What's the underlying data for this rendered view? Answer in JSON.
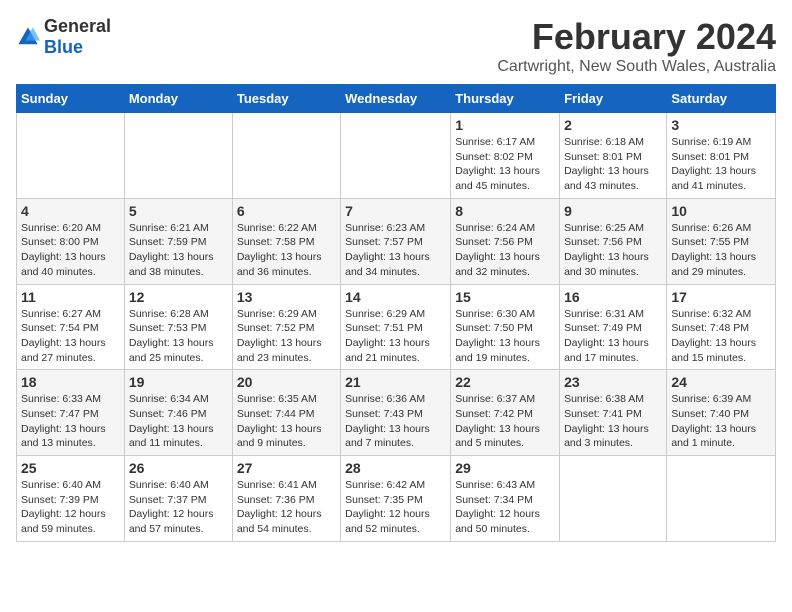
{
  "header": {
    "logo_general": "General",
    "logo_blue": "Blue",
    "main_title": "February 2024",
    "subtitle": "Cartwright, New South Wales, Australia"
  },
  "days_of_week": [
    "Sunday",
    "Monday",
    "Tuesday",
    "Wednesday",
    "Thursday",
    "Friday",
    "Saturday"
  ],
  "weeks": [
    [
      {
        "day": "",
        "info": ""
      },
      {
        "day": "",
        "info": ""
      },
      {
        "day": "",
        "info": ""
      },
      {
        "day": "",
        "info": ""
      },
      {
        "day": "1",
        "info": "Sunrise: 6:17 AM\nSunset: 8:02 PM\nDaylight: 13 hours\nand 45 minutes."
      },
      {
        "day": "2",
        "info": "Sunrise: 6:18 AM\nSunset: 8:01 PM\nDaylight: 13 hours\nand 43 minutes."
      },
      {
        "day": "3",
        "info": "Sunrise: 6:19 AM\nSunset: 8:01 PM\nDaylight: 13 hours\nand 41 minutes."
      }
    ],
    [
      {
        "day": "4",
        "info": "Sunrise: 6:20 AM\nSunset: 8:00 PM\nDaylight: 13 hours\nand 40 minutes."
      },
      {
        "day": "5",
        "info": "Sunrise: 6:21 AM\nSunset: 7:59 PM\nDaylight: 13 hours\nand 38 minutes."
      },
      {
        "day": "6",
        "info": "Sunrise: 6:22 AM\nSunset: 7:58 PM\nDaylight: 13 hours\nand 36 minutes."
      },
      {
        "day": "7",
        "info": "Sunrise: 6:23 AM\nSunset: 7:57 PM\nDaylight: 13 hours\nand 34 minutes."
      },
      {
        "day": "8",
        "info": "Sunrise: 6:24 AM\nSunset: 7:56 PM\nDaylight: 13 hours\nand 32 minutes."
      },
      {
        "day": "9",
        "info": "Sunrise: 6:25 AM\nSunset: 7:56 PM\nDaylight: 13 hours\nand 30 minutes."
      },
      {
        "day": "10",
        "info": "Sunrise: 6:26 AM\nSunset: 7:55 PM\nDaylight: 13 hours\nand 29 minutes."
      }
    ],
    [
      {
        "day": "11",
        "info": "Sunrise: 6:27 AM\nSunset: 7:54 PM\nDaylight: 13 hours\nand 27 minutes."
      },
      {
        "day": "12",
        "info": "Sunrise: 6:28 AM\nSunset: 7:53 PM\nDaylight: 13 hours\nand 25 minutes."
      },
      {
        "day": "13",
        "info": "Sunrise: 6:29 AM\nSunset: 7:52 PM\nDaylight: 13 hours\nand 23 minutes."
      },
      {
        "day": "14",
        "info": "Sunrise: 6:29 AM\nSunset: 7:51 PM\nDaylight: 13 hours\nand 21 minutes."
      },
      {
        "day": "15",
        "info": "Sunrise: 6:30 AM\nSunset: 7:50 PM\nDaylight: 13 hours\nand 19 minutes."
      },
      {
        "day": "16",
        "info": "Sunrise: 6:31 AM\nSunset: 7:49 PM\nDaylight: 13 hours\nand 17 minutes."
      },
      {
        "day": "17",
        "info": "Sunrise: 6:32 AM\nSunset: 7:48 PM\nDaylight: 13 hours\nand 15 minutes."
      }
    ],
    [
      {
        "day": "18",
        "info": "Sunrise: 6:33 AM\nSunset: 7:47 PM\nDaylight: 13 hours\nand 13 minutes."
      },
      {
        "day": "19",
        "info": "Sunrise: 6:34 AM\nSunset: 7:46 PM\nDaylight: 13 hours\nand 11 minutes."
      },
      {
        "day": "20",
        "info": "Sunrise: 6:35 AM\nSunset: 7:44 PM\nDaylight: 13 hours\nand 9 minutes."
      },
      {
        "day": "21",
        "info": "Sunrise: 6:36 AM\nSunset: 7:43 PM\nDaylight: 13 hours\nand 7 minutes."
      },
      {
        "day": "22",
        "info": "Sunrise: 6:37 AM\nSunset: 7:42 PM\nDaylight: 13 hours\nand 5 minutes."
      },
      {
        "day": "23",
        "info": "Sunrise: 6:38 AM\nSunset: 7:41 PM\nDaylight: 13 hours\nand 3 minutes."
      },
      {
        "day": "24",
        "info": "Sunrise: 6:39 AM\nSunset: 7:40 PM\nDaylight: 13 hours\nand 1 minute."
      }
    ],
    [
      {
        "day": "25",
        "info": "Sunrise: 6:40 AM\nSunset: 7:39 PM\nDaylight: 12 hours\nand 59 minutes."
      },
      {
        "day": "26",
        "info": "Sunrise: 6:40 AM\nSunset: 7:37 PM\nDaylight: 12 hours\nand 57 minutes."
      },
      {
        "day": "27",
        "info": "Sunrise: 6:41 AM\nSunset: 7:36 PM\nDaylight: 12 hours\nand 54 minutes."
      },
      {
        "day": "28",
        "info": "Sunrise: 6:42 AM\nSunset: 7:35 PM\nDaylight: 12 hours\nand 52 minutes."
      },
      {
        "day": "29",
        "info": "Sunrise: 6:43 AM\nSunset: 7:34 PM\nDaylight: 12 hours\nand 50 minutes."
      },
      {
        "day": "",
        "info": ""
      },
      {
        "day": "",
        "info": ""
      }
    ]
  ]
}
